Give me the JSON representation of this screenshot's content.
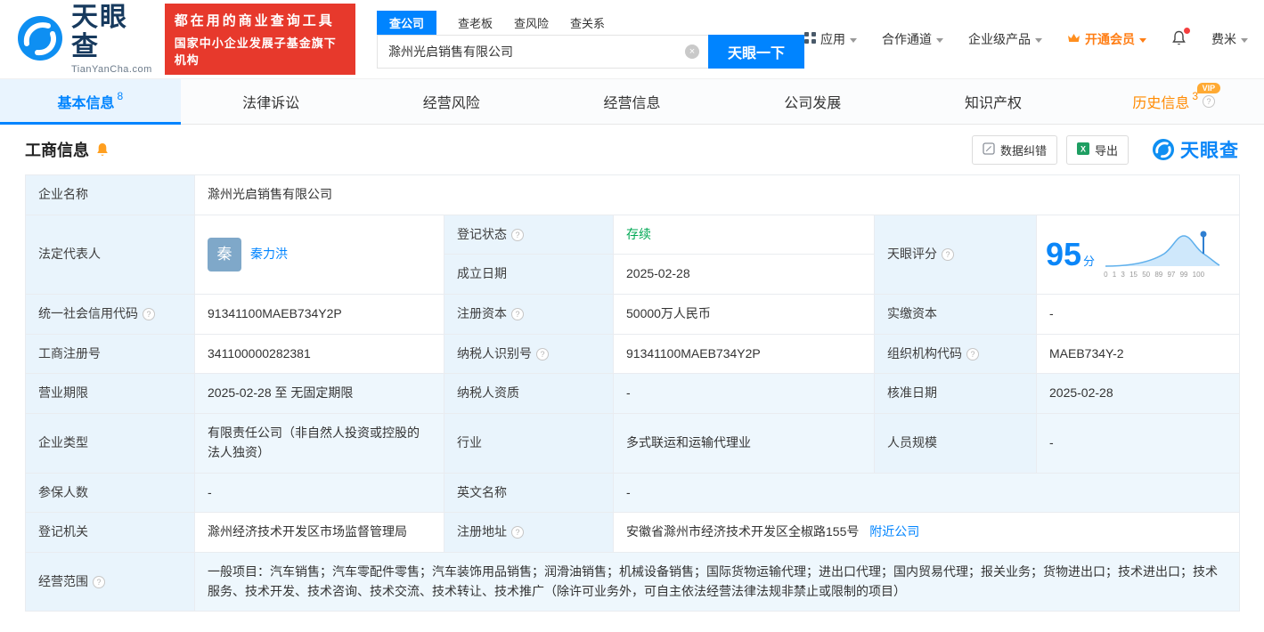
{
  "icons": {
    "help": "?",
    "clear": "×",
    "export_x": "X"
  },
  "header": {
    "logo_title": "天眼查",
    "logo_subtitle": "TianYanCha.com",
    "banner_line1": "都在用的商业查询工具",
    "banner_line2": "国家中小企业发展子基金旗下机构",
    "search_tabs": [
      {
        "label": "查公司"
      },
      {
        "label": "查老板"
      },
      {
        "label": "查风险"
      },
      {
        "label": "查关系"
      }
    ],
    "search_value": "滁州光启销售有限公司",
    "search_button": "天眼一下",
    "nav_app": "应用",
    "nav_coop": "合作通道",
    "nav_enterprise": "企业级产品",
    "nav_vip": "开通会员",
    "nav_user": "费米"
  },
  "tabs": [
    {
      "label": "基本信息",
      "badge": "8"
    },
    {
      "label": "法律诉讼"
    },
    {
      "label": "经营风险"
    },
    {
      "label": "经营信息"
    },
    {
      "label": "公司发展"
    },
    {
      "label": "知识产权"
    },
    {
      "label": "历史信息",
      "badge": "3",
      "tag": "VIP"
    }
  ],
  "section": {
    "title": "工商信息",
    "btn_correction": "数据纠错",
    "btn_export": "导出",
    "watermark": "天眼查"
  },
  "score": {
    "label": "天眼评分",
    "value": "95",
    "unit": "分",
    "axis": "0 1 3 15 50 89 97 99 100"
  },
  "fields": {
    "company_name": {
      "label": "企业名称",
      "value": "滁州光启销售有限公司"
    },
    "legal_rep": {
      "label": "法定代表人",
      "avatar": "秦",
      "value": "秦力洪"
    },
    "reg_status": {
      "label": "登记状态",
      "value": "存续"
    },
    "establish_date": {
      "label": "成立日期",
      "value": "2025-02-28"
    },
    "credit_code": {
      "label": "统一社会信用代码",
      "value": "91341100MAEB734Y2P"
    },
    "reg_capital": {
      "label": "注册资本",
      "value": "50000万人民币"
    },
    "paid_capital": {
      "label": "实缴资本",
      "value": "-"
    },
    "reg_number": {
      "label": "工商注册号",
      "value": "341100000282381"
    },
    "taxpayer_id": {
      "label": "纳税人识别号",
      "value": "91341100MAEB734Y2P"
    },
    "org_code": {
      "label": "组织机构代码",
      "value": "MAEB734Y-2"
    },
    "business_term": {
      "label": "营业期限",
      "value": "2025-02-28 至 无固定期限"
    },
    "taxpayer_quality": {
      "label": "纳税人资质",
      "value": "-"
    },
    "approval_date": {
      "label": "核准日期",
      "value": "2025-02-28"
    },
    "company_type": {
      "label": "企业类型",
      "value": "有限责任公司（非自然人投资或控股的法人独资）"
    },
    "industry": {
      "label": "行业",
      "value": "多式联运和运输代理业"
    },
    "staff_size": {
      "label": "人员规模",
      "value": "-"
    },
    "insured_count": {
      "label": "参保人数",
      "value": "-"
    },
    "english_name": {
      "label": "英文名称",
      "value": "-"
    },
    "reg_authority": {
      "label": "登记机关",
      "value": "滁州经济技术开发区市场监督管理局"
    },
    "reg_address": {
      "label": "注册地址",
      "value": "安徽省滁州市经济技术开发区全椒路155号",
      "link": "附近公司"
    },
    "business_scope": {
      "label": "经营范围",
      "value": "一般项目：汽车销售；汽车零配件零售；汽车装饰用品销售；润滑油销售；机械设备销售；国际货物运输代理；进出口代理；国内贸易代理；报关业务；货物进出口；技术进出口；技术服务、技术开发、技术咨询、技术交流、技术转让、技术推广（除许可业务外，可自主依法经营法律法规非禁止或限制的项目）"
    }
  }
}
